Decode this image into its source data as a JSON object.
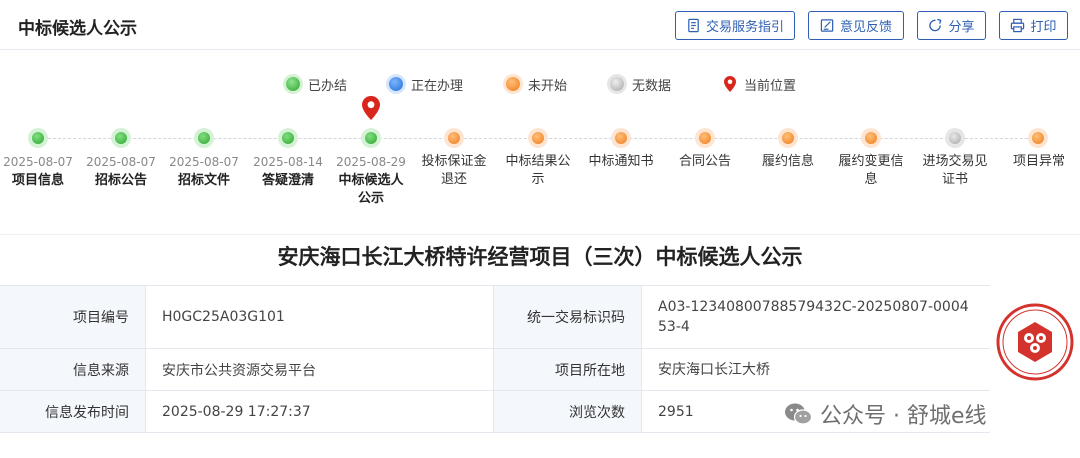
{
  "header": {
    "title": "中标候选人公示",
    "buttons": [
      {
        "label": "交易服务指引",
        "icon": "guide-icon"
      },
      {
        "label": "意见反馈",
        "icon": "feedback-icon"
      },
      {
        "label": "分享",
        "icon": "share-icon"
      },
      {
        "label": "打印",
        "icon": "print-icon"
      }
    ]
  },
  "legend": [
    {
      "label": "已办结",
      "color": "#3cb93c"
    },
    {
      "label": "正在办理",
      "color": "#2f7fe0"
    },
    {
      "label": "未开始",
      "color": "#f3862a"
    },
    {
      "label": "无数据",
      "color": "#b5b5b5"
    },
    {
      "label": "当前位置",
      "color": "#d9261c"
    }
  ],
  "steps": [
    {
      "date": "2025-08-07",
      "name": "项目信息",
      "status": "done"
    },
    {
      "date": "2025-08-07",
      "name": "招标公告",
      "status": "done"
    },
    {
      "date": "2025-08-07",
      "name": "招标文件",
      "status": "done"
    },
    {
      "date": "2025-08-14",
      "name": "答疑澄清",
      "status": "done"
    },
    {
      "date": "2025-08-29",
      "name": "中标候选人\n公示",
      "status": "done",
      "current": true
    },
    {
      "date": "",
      "name": "投标保证金\n退还",
      "status": "pending"
    },
    {
      "date": "",
      "name": "中标结果公\n示",
      "status": "pending"
    },
    {
      "date": "",
      "name": "中标通知书",
      "status": "pending"
    },
    {
      "date": "",
      "name": "合同公告",
      "status": "pending"
    },
    {
      "date": "",
      "name": "履约信息",
      "status": "pending"
    },
    {
      "date": "",
      "name": "履约变更信\n息",
      "status": "pending"
    },
    {
      "date": "",
      "name": "进场交易见\n证书",
      "status": "nodata"
    },
    {
      "date": "",
      "name": "项目异常",
      "status": "pending"
    }
  ],
  "notice": {
    "title": "安庆海口长江大桥特许经营项目（三次）中标候选人公示"
  },
  "info": {
    "project_no_label": "项目编号",
    "project_no": "H0GC25A03G101",
    "trade_id_label": "统一交易标识码",
    "trade_id": "A03-12340800788579432C-20250807-000453-4",
    "source_label": "信息来源",
    "source": "安庆市公共资源交易平台",
    "location_label": "项目所在地",
    "location": "安庆海口长江大桥",
    "publish_time_label": "信息发布时间",
    "publish_time": "2025-08-29 17:27:37",
    "views_label": "浏览次数",
    "views": "2951"
  },
  "watermark": {
    "text": "公众号 · 舒城e线"
  }
}
